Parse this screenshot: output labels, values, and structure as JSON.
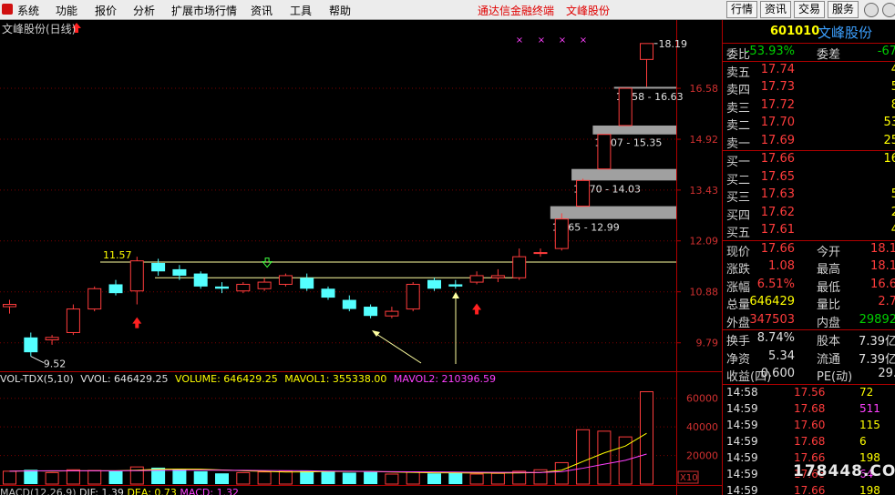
{
  "menu": {
    "items": [
      "系统",
      "功能",
      "报价",
      "分析",
      "扩展市场行情",
      "资讯",
      "工具",
      "帮助"
    ],
    "broker": "通达信金融终端",
    "stock_name": "文峰股份",
    "buttons": [
      "行情",
      "资讯",
      "交易",
      "服务"
    ]
  },
  "chart": {
    "title": "文峰股份(日线)",
    "price_labels": [
      "16.58",
      "14.92",
      "13.43",
      "12.09",
      "10.88",
      "9.79"
    ],
    "price_min": 9.3,
    "price_max": 18.6,
    "annotations": {
      "high": "18.19",
      "low": "9.52",
      "resistance": "11.57",
      "gap1": "16.58 - 16.63",
      "gap2": "15.07 - 15.35",
      "gap3": "13.70 - 14.03",
      "gap4": "12.65 - 12.99"
    },
    "volume_labels": [
      "60000",
      "40000",
      "20000"
    ],
    "volume_unit": "X10",
    "candles": [
      {
        "o": 10.55,
        "c": 10.6,
        "h": 10.7,
        "l": 10.4
      },
      {
        "o": 9.9,
        "c": 9.6,
        "h": 10.0,
        "l": 9.52
      },
      {
        "o": 9.85,
        "c": 9.9,
        "h": 9.95,
        "l": 9.75
      },
      {
        "o": 10.0,
        "c": 10.5,
        "h": 10.6,
        "l": 9.95
      },
      {
        "o": 10.5,
        "c": 10.95,
        "h": 11.0,
        "l": 10.45
      },
      {
        "o": 11.05,
        "c": 10.85,
        "h": 11.15,
        "l": 10.8
      },
      {
        "o": 10.9,
        "c": 11.6,
        "h": 11.7,
        "l": 10.6
      },
      {
        "o": 11.55,
        "c": 11.35,
        "h": 11.65,
        "l": 11.25
      },
      {
        "o": 11.4,
        "c": 11.25,
        "h": 11.5,
        "l": 11.15
      },
      {
        "o": 11.3,
        "c": 11.0,
        "h": 11.35,
        "l": 10.95
      },
      {
        "o": 11.0,
        "c": 10.95,
        "h": 11.1,
        "l": 10.85
      },
      {
        "o": 10.9,
        "c": 11.05,
        "h": 11.1,
        "l": 10.85
      },
      {
        "o": 10.95,
        "c": 11.1,
        "h": 11.2,
        "l": 10.9
      },
      {
        "o": 11.05,
        "c": 11.25,
        "h": 11.3,
        "l": 11.0
      },
      {
        "o": 11.2,
        "c": 10.95,
        "h": 11.3,
        "l": 10.9
      },
      {
        "o": 10.95,
        "c": 10.75,
        "h": 11.0,
        "l": 10.7
      },
      {
        "o": 10.7,
        "c": 10.5,
        "h": 10.8,
        "l": 10.45
      },
      {
        "o": 10.55,
        "c": 10.35,
        "h": 10.6,
        "l": 10.3
      },
      {
        "o": 10.35,
        "c": 10.45,
        "h": 10.55,
        "l": 10.3
      },
      {
        "o": 10.5,
        "c": 11.05,
        "h": 11.1,
        "l": 10.45
      },
      {
        "o": 11.15,
        "c": 10.95,
        "h": 11.2,
        "l": 10.9
      },
      {
        "o": 11.05,
        "c": 11.0,
        "h": 11.15,
        "l": 10.95
      },
      {
        "o": 11.1,
        "c": 11.25,
        "h": 11.35,
        "l": 11.05
      },
      {
        "o": 11.2,
        "c": 11.25,
        "h": 11.4,
        "l": 11.1
      },
      {
        "o": 11.2,
        "c": 11.7,
        "h": 11.9,
        "l": 11.15
      },
      {
        "o": 11.8,
        "c": 11.8,
        "h": 11.9,
        "l": 11.7
      },
      {
        "o": 11.9,
        "c": 12.65,
        "h": 12.8,
        "l": 11.85
      },
      {
        "o": 12.99,
        "c": 13.7,
        "h": 13.75,
        "l": 12.99
      },
      {
        "o": 14.03,
        "c": 15.07,
        "h": 15.07,
        "l": 14.03
      },
      {
        "o": 15.35,
        "c": 16.58,
        "h": 16.58,
        "l": 15.35
      },
      {
        "o": 17.6,
        "c": 18.19,
        "h": 18.19,
        "l": 16.63
      }
    ],
    "volumes": [
      9000,
      10000,
      8000,
      10000,
      9500,
      9000,
      12000,
      11500,
      10500,
      9000,
      7500,
      8000,
      8500,
      9000,
      9500,
      9000,
      8000,
      8500,
      7000,
      8500,
      7500,
      8000,
      7000,
      7500,
      9000,
      10000,
      15000,
      38000,
      37000,
      33000,
      64600
    ],
    "mavol1": [
      9000,
      9300,
      9100,
      9300,
      9300,
      9300,
      9700,
      10400,
      10500,
      10400,
      9900,
      9300,
      8900,
      8400,
      8500,
      8800,
      8800,
      8800,
      8400,
      8200,
      7900,
      7900,
      7700,
      7700,
      7800,
      8100,
      9700,
      15800,
      21800,
      26600,
      35500
    ],
    "mavol2": [
      9000,
      9200,
      9300,
      9300,
      9300,
      9300,
      9400,
      9600,
      9700,
      9800,
      9700,
      9600,
      9500,
      9400,
      9300,
      9100,
      9000,
      8800,
      8700,
      8600,
      8500,
      8400,
      8300,
      8200,
      8200,
      8100,
      8700,
      11100,
      13900,
      16600,
      21000
    ]
  },
  "indicator": {
    "name": "VOL-TDX(5,10)",
    "vol": "VVOL: 646429.25",
    "volume": "VOLUME: 646429.25",
    "mavol1": "MAVOL1: 355338.00",
    "mavol2": "MAVOL2: 210396.59"
  },
  "macd": {
    "name": "MACD(12,26,9)",
    "dif": "DIF: 1.39",
    "dea": "DEA: 0.73",
    "macd": "MACD: 1.32"
  },
  "colors": {
    "up": "#ff3c3c",
    "down": "#54ffff",
    "mavol1": "#ffff00",
    "mavol2": "#ff40ff",
    "gap": "#a0a0a0",
    "panel_border": "#b00000"
  },
  "quote": {
    "code": "601010",
    "name": "文峰股份",
    "ratio_label": "委比",
    "ratio": "-53.93%",
    "diff_label": "委差",
    "diff": "-67",
    "sell": [
      {
        "label": "卖五",
        "price": "17.74",
        "vol": "4"
      },
      {
        "label": "卖四",
        "price": "17.73",
        "vol": "5"
      },
      {
        "label": "卖三",
        "price": "17.72",
        "vol": "8"
      },
      {
        "label": "卖二",
        "price": "17.70",
        "vol": "53"
      },
      {
        "label": "卖一",
        "price": "17.69",
        "vol": "25"
      }
    ],
    "buy": [
      {
        "label": "买一",
        "price": "17.66",
        "vol": "16"
      },
      {
        "label": "买二",
        "price": "17.65",
        "vol": ""
      },
      {
        "label": "买三",
        "price": "17.63",
        "vol": "5"
      },
      {
        "label": "买四",
        "price": "17.62",
        "vol": "2"
      },
      {
        "label": "买五",
        "price": "17.61",
        "vol": "4"
      }
    ],
    "stats": [
      {
        "l1": "现价",
        "v1": "17.66",
        "c1": "red",
        "l2": "今开",
        "v2": "18.1",
        "c2": "red"
      },
      {
        "l1": "涨跌",
        "v1": "1.08",
        "c1": "red",
        "l2": "最高",
        "v2": "18.1",
        "c2": "red"
      },
      {
        "l1": "涨幅",
        "v1": "6.51%",
        "c1": "red",
        "l2": "最低",
        "v2": "16.6",
        "c2": "red"
      },
      {
        "l1": "总量",
        "v1": "646429",
        "c1": "yellow",
        "l2": "量比",
        "v2": "2.7",
        "c2": "red"
      },
      {
        "l1": "外盘",
        "v1": "347503",
        "c1": "red",
        "l2": "内盘",
        "v2": "29892",
        "c2": "green"
      }
    ],
    "fund": [
      {
        "l1": "换手",
        "v1": "8.74%",
        "l2": "股本",
        "v2": "7.39亿"
      },
      {
        "l1": "净资",
        "v1": "5.34",
        "l2": "流通",
        "v2": "7.39亿"
      },
      {
        "l1": "收益(四)",
        "v1": "0.600",
        "l2": "PE(动)",
        "v2": "29."
      }
    ],
    "ticks": [
      {
        "time": "14:58",
        "price": "17.56",
        "vol": "72",
        "vc": "yellow"
      },
      {
        "time": "14:59",
        "price": "17.68",
        "vol": "511",
        "vc": "magenta"
      },
      {
        "time": "14:59",
        "price": "17.60",
        "vol": "115",
        "vc": "yellow"
      },
      {
        "time": "14:59",
        "price": "17.68",
        "vol": "6",
        "vc": "yellow"
      },
      {
        "time": "14:59",
        "price": "17.66",
        "vol": "198",
        "vc": "yellow"
      },
      {
        "time": "14:59",
        "price": "17.66",
        "vol": "64",
        "vc": "magenta"
      },
      {
        "time": "14:59",
        "price": "17.66",
        "vol": "198",
        "vc": "yellow"
      }
    ],
    "watermark": "178448.COM"
  }
}
